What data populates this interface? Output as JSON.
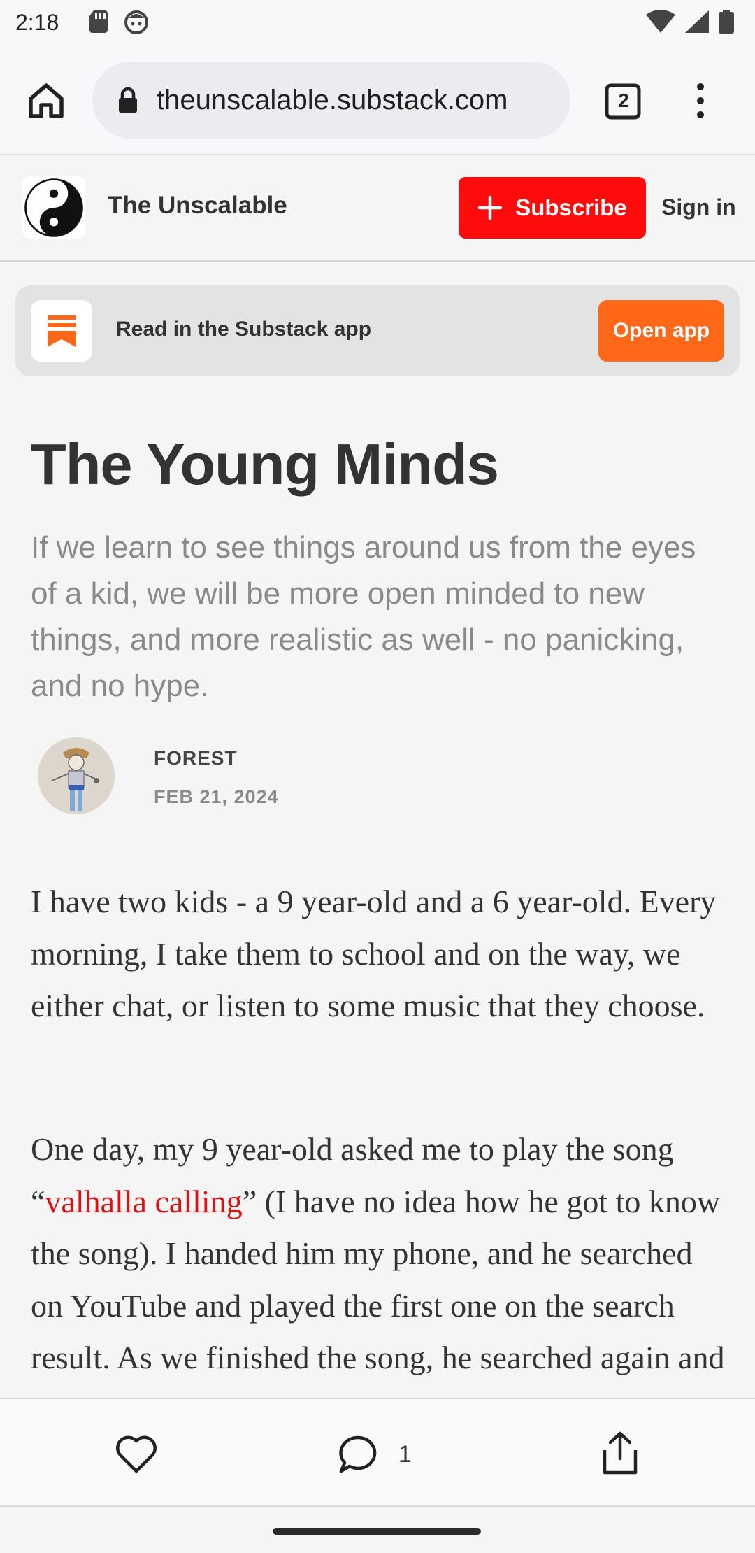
{
  "status_bar": {
    "time": "2:18",
    "icons_left": [
      "sd-card-icon",
      "face-icon"
    ],
    "icons_right": [
      "wifi-icon",
      "cell-signal-icon",
      "battery-icon"
    ]
  },
  "browser": {
    "url": "theunscalable.substack.com",
    "tab_count": "2"
  },
  "site": {
    "name": "The Unscalable",
    "subscribe_label": "Subscribe",
    "signin_label": "Sign in",
    "accent_color": "#ff0b0b"
  },
  "app_banner": {
    "text": "Read in the Substack app",
    "button_label": "Open app",
    "button_color": "#ff6719"
  },
  "article": {
    "title": "The Young Minds",
    "subtitle": "If we learn to see things around us from the eyes of a kid, we will be more open minded to new things, and more realistic as well - no panicking, and no hype.",
    "author": "FOREST",
    "date": "FEB 21, 2024",
    "paragraph1": "I have two kids - a 9 year-old and a 6 year-old. Every morning, I take them to school and on the way, we either chat, or listen to some music that they choose.",
    "paragraph2_before": "One day, my 9 year-old asked me to play the song “",
    "paragraph2_link": "valhalla calling",
    "paragraph2_after": "” (I have no idea how he got to know the song). I handed him my phone, and he searched on YouTube and played the first one on the search result. As we finished the song, he searched again and we played"
  },
  "actions": {
    "comment_count": "1"
  }
}
